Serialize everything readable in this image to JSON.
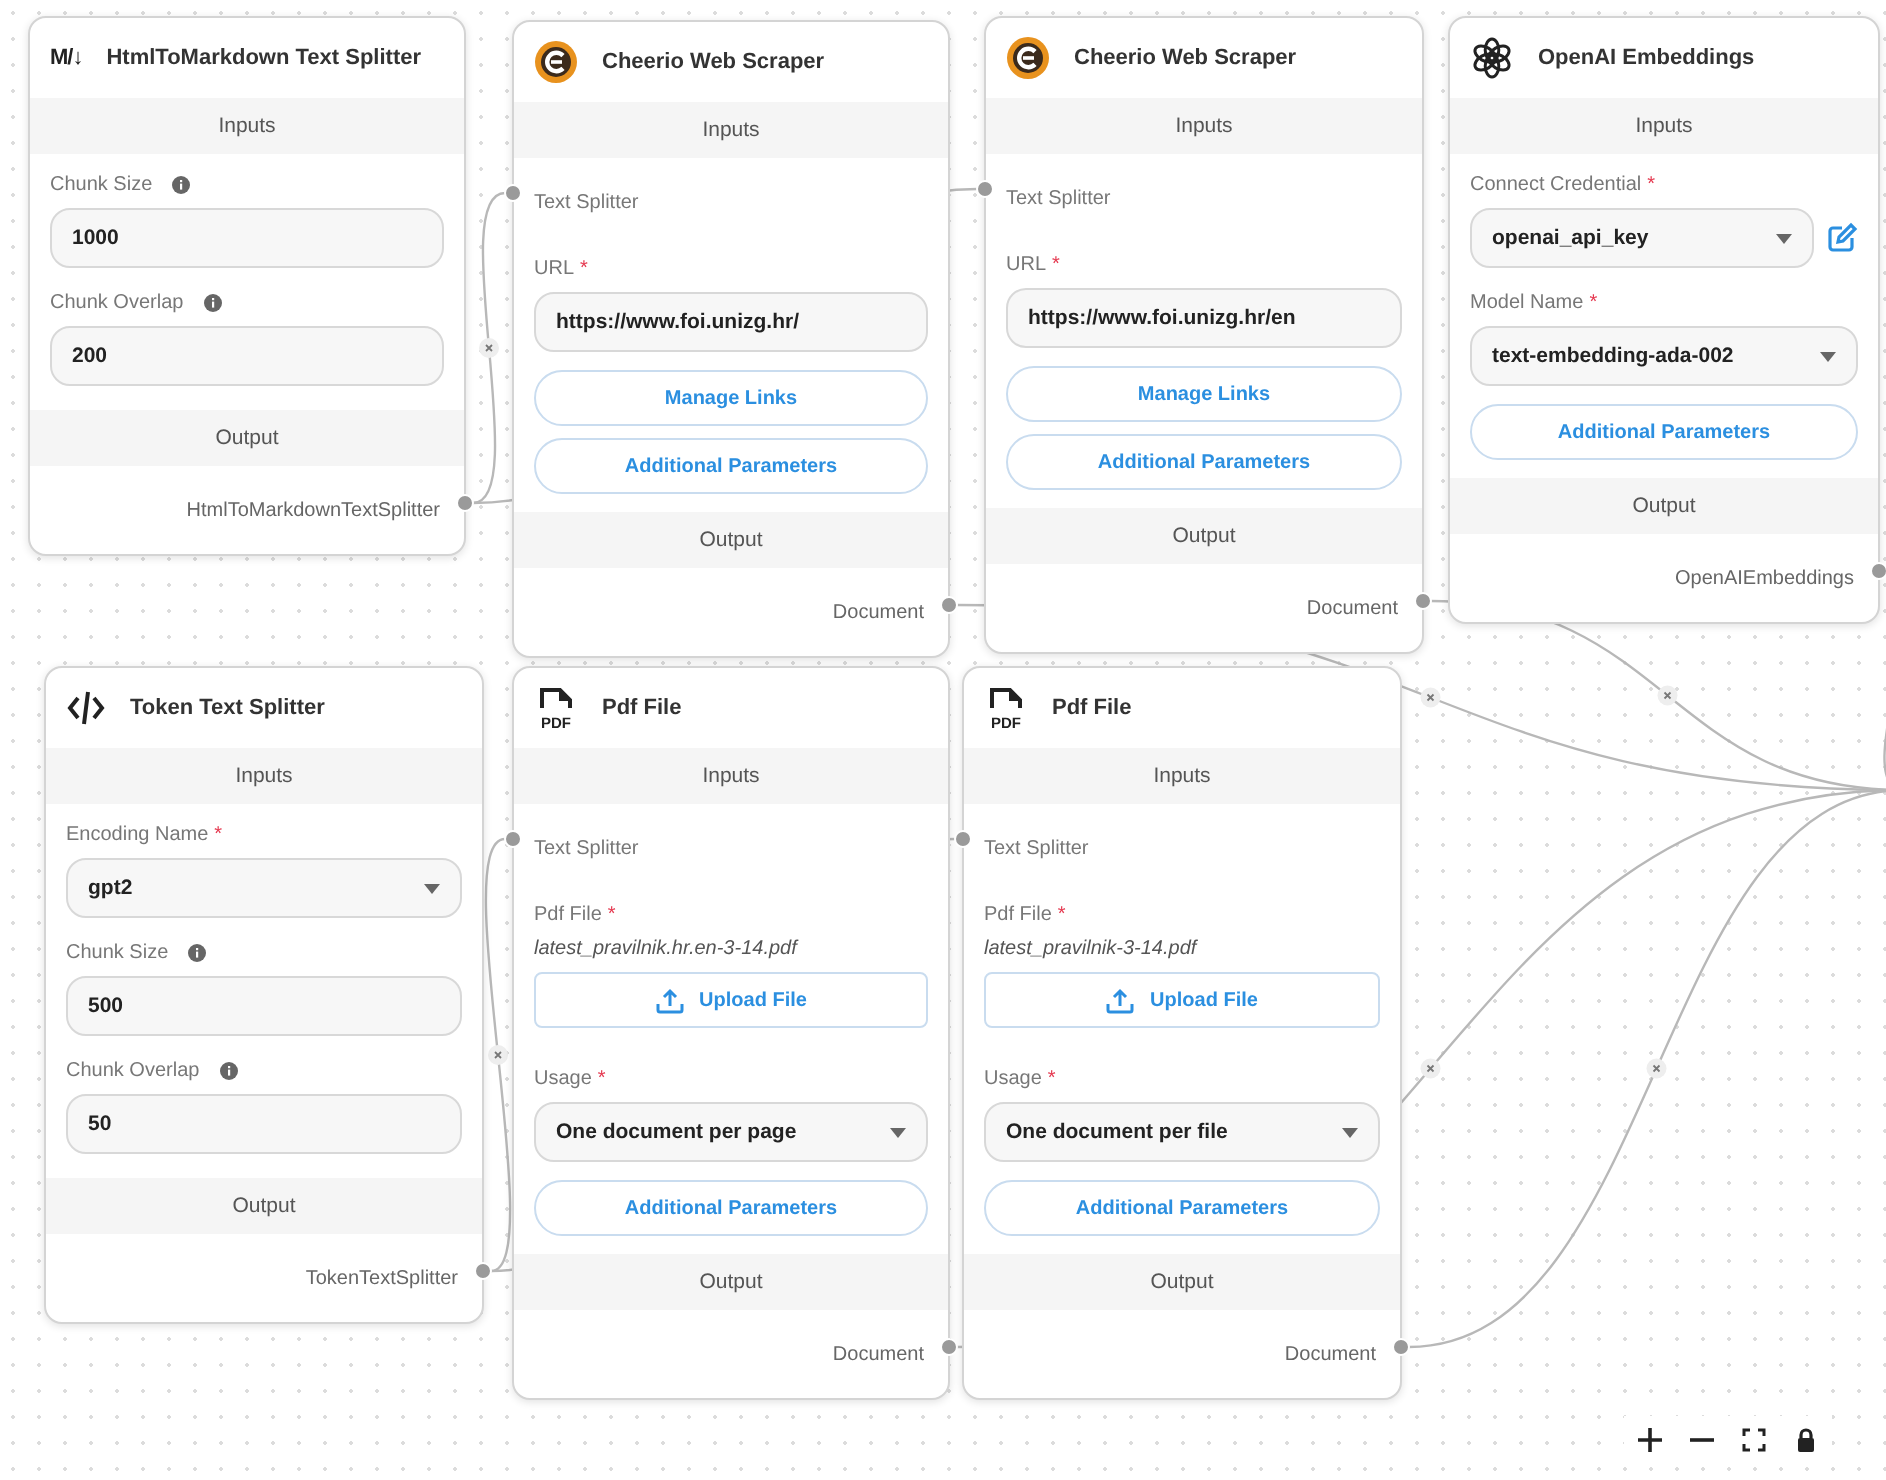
{
  "nodes": [
    {
      "kind": "markdown",
      "icon_text": "M/↓",
      "title": "HtmlToMarkdown Text Splitter",
      "inputs_heading": "Inputs",
      "inputs": [
        {
          "kind": "field",
          "label": "Chunk Size",
          "info": true,
          "value": "1000"
        },
        {
          "kind": "field",
          "label": "Chunk Overlap",
          "info": true,
          "value": "200"
        }
      ],
      "output_heading": "Output",
      "output": "HtmlToMarkdownTextSplitter"
    },
    {
      "kind": "cheerio",
      "title": "Cheerio Web Scraper",
      "inputs_heading": "Inputs",
      "inputs": [
        {
          "kind": "anchor",
          "label": "Text Splitter"
        },
        {
          "kind": "field",
          "label": "URL",
          "mark": "*",
          "value": "https://www.foi.unizg.hr/"
        },
        {
          "kind": "button",
          "label": "Manage Links"
        },
        {
          "kind": "button",
          "label": "Additional Parameters"
        }
      ],
      "output_heading": "Output",
      "output": "Document"
    },
    {
      "kind": "cheerio",
      "title": "Cheerio Web Scraper",
      "inputs_heading": "Inputs",
      "inputs": [
        {
          "kind": "anchor",
          "label": "Text Splitter"
        },
        {
          "kind": "field",
          "label": "URL",
          "mark": "*",
          "value": "https://www.foi.unizg.hr/en"
        },
        {
          "kind": "button",
          "label": "Manage Links"
        },
        {
          "kind": "button",
          "label": "Additional Parameters"
        }
      ],
      "output_heading": "Output",
      "output": "Document"
    },
    {
      "kind": "openai",
      "title": "OpenAI Embeddings",
      "inputs_heading": "Inputs",
      "inputs": [
        {
          "kind": "select",
          "label": "Connect Credential",
          "mark": "*",
          "value": "openai_api_key",
          "editable": true
        },
        {
          "kind": "select",
          "label": "Model Name",
          "mark": "*",
          "value": "text-embedding-ada-002"
        },
        {
          "kind": "button",
          "label": "Additional Parameters"
        }
      ],
      "output_heading": "Output",
      "output": "OpenAIEmbeddings"
    },
    {
      "kind": "token",
      "title": "Token Text Splitter",
      "inputs_heading": "Inputs",
      "inputs": [
        {
          "kind": "select",
          "label": "Encoding Name",
          "mark": "*",
          "value": "gpt2"
        },
        {
          "kind": "field",
          "label": "Chunk Size",
          "info": true,
          "value": "500"
        },
        {
          "kind": "field",
          "label": "Chunk Overlap",
          "info": true,
          "value": "50"
        }
      ],
      "output_heading": "Output",
      "output": "TokenTextSplitter"
    },
    {
      "kind": "pdf",
      "icon_text": "PDF",
      "title": "Pdf File",
      "inputs_heading": "Inputs",
      "inputs": [
        {
          "kind": "anchor",
          "label": "Text Splitter"
        },
        {
          "kind": "file",
          "label": "Pdf File",
          "mark": "*",
          "file": "latest_pravilnik.hr.en-3-14.pdf",
          "button": "Upload File"
        },
        {
          "kind": "select",
          "label": "Usage",
          "mark": "*",
          "value": "One document per page"
        },
        {
          "kind": "button",
          "label": "Additional Parameters"
        }
      ],
      "output_heading": "Output",
      "output": "Document"
    },
    {
      "kind": "pdf",
      "icon_text": "PDF",
      "title": "Pdf File",
      "inputs_heading": "Inputs",
      "inputs": [
        {
          "kind": "anchor",
          "label": "Text Splitter"
        },
        {
          "kind": "file",
          "label": "Pdf File",
          "mark": "*",
          "file": "latest_pravilnik-3-14.pdf",
          "button": "Upload File"
        },
        {
          "kind": "select",
          "label": "Usage",
          "mark": "*",
          "value": "One document per file"
        },
        {
          "kind": "button",
          "label": "Additional Parameters"
        }
      ],
      "output_heading": "Output",
      "output": "Document"
    }
  ],
  "controls": [
    {
      "kind": "zoom_in"
    },
    {
      "kind": "zoom_out"
    },
    {
      "kind": "fit_view"
    },
    {
      "kind": "lock"
    }
  ]
}
